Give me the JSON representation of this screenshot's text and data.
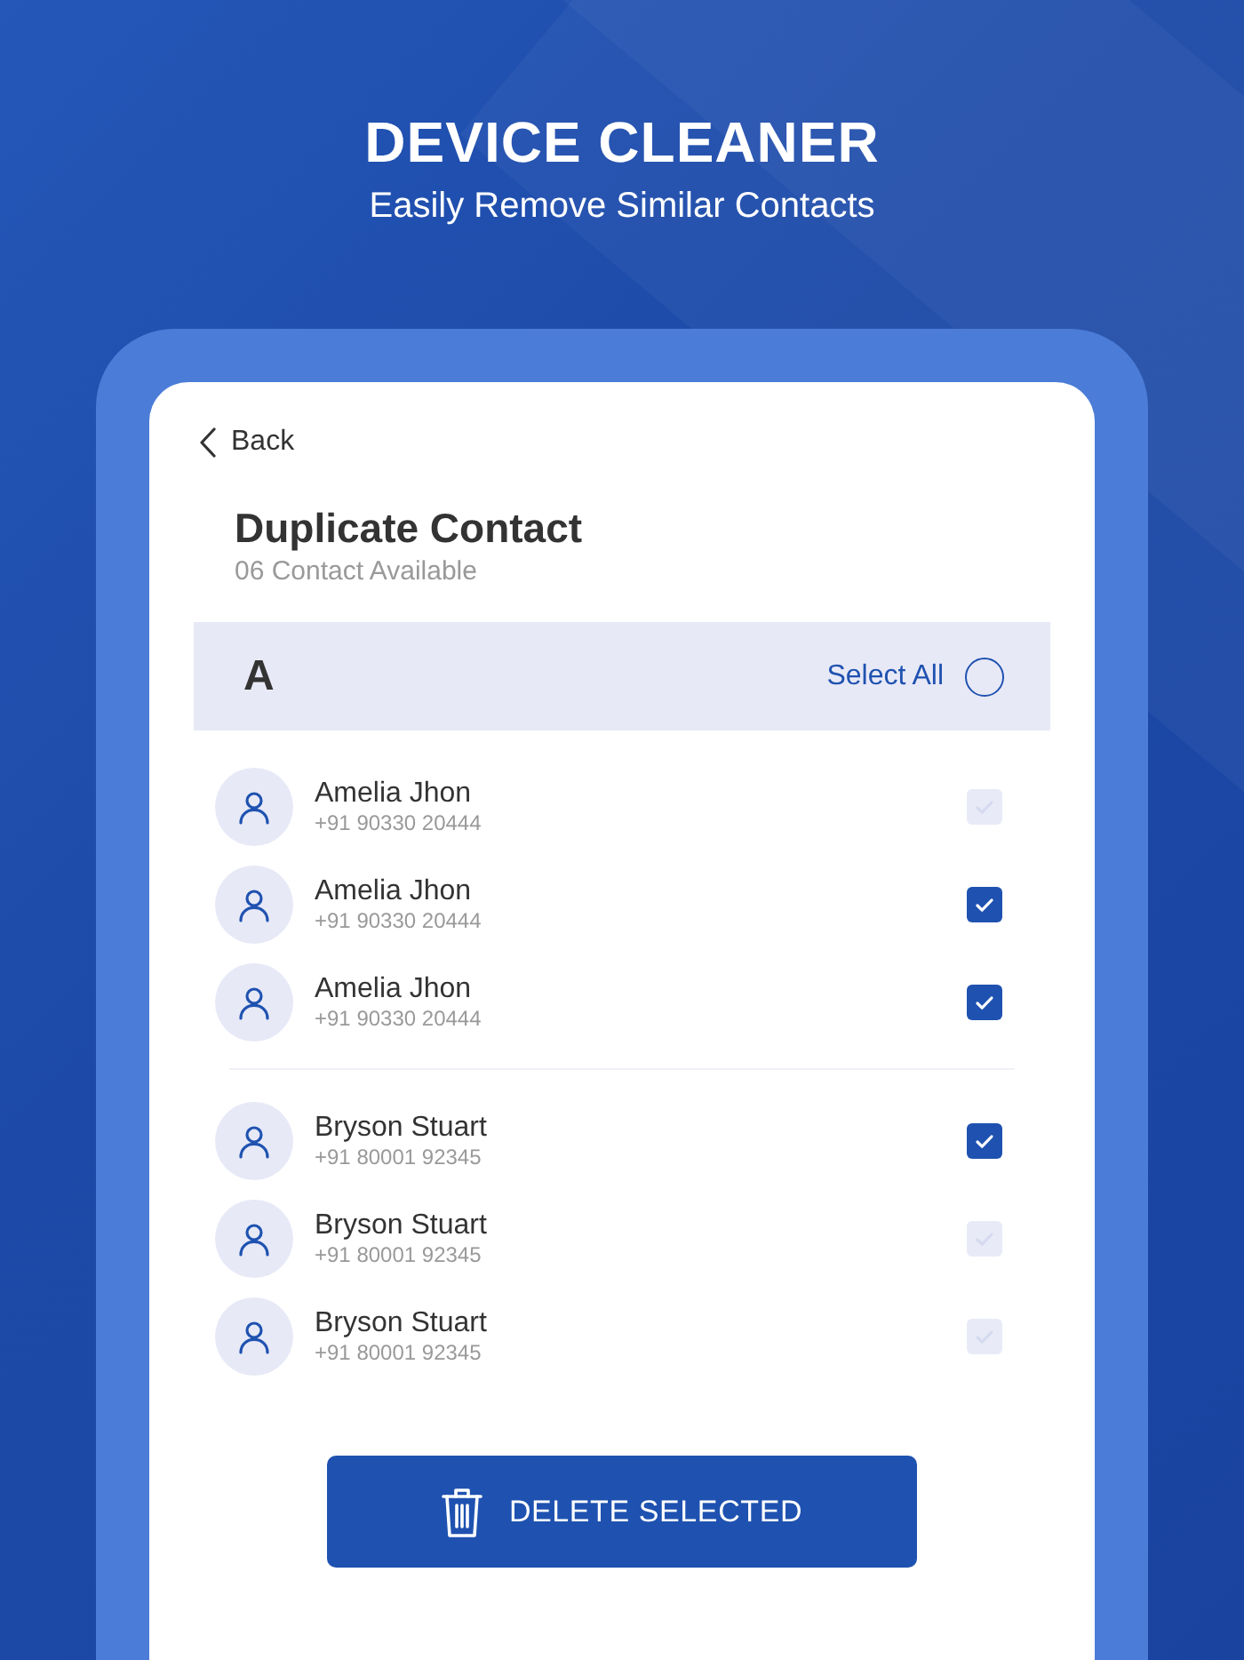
{
  "hero": {
    "title": "DEVICE CLEANER",
    "subtitle": "Easily Remove Similar Contacts"
  },
  "back": {
    "label": "Back"
  },
  "page": {
    "title": "Duplicate Contact",
    "count": "06 Contact Available"
  },
  "section": {
    "letter": "A",
    "select_all": {
      "label": "Select All",
      "selected": false
    }
  },
  "groups": [
    {
      "contacts": [
        {
          "name": "Amelia Jhon",
          "phone": "+91 90330 20444",
          "checked": false
        },
        {
          "name": "Amelia Jhon",
          "phone": "+91 90330 20444",
          "checked": true
        },
        {
          "name": "Amelia Jhon",
          "phone": "+91 90330 20444",
          "checked": true
        }
      ]
    },
    {
      "contacts": [
        {
          "name": "Bryson Stuart",
          "phone": "+91 80001 92345",
          "checked": true
        },
        {
          "name": "Bryson Stuart",
          "phone": "+91 80001 92345",
          "checked": false
        },
        {
          "name": "Bryson Stuart",
          "phone": "+91 80001 92345",
          "checked": false
        }
      ]
    }
  ],
  "delete_button": {
    "label": "DELETE SELECTED"
  }
}
